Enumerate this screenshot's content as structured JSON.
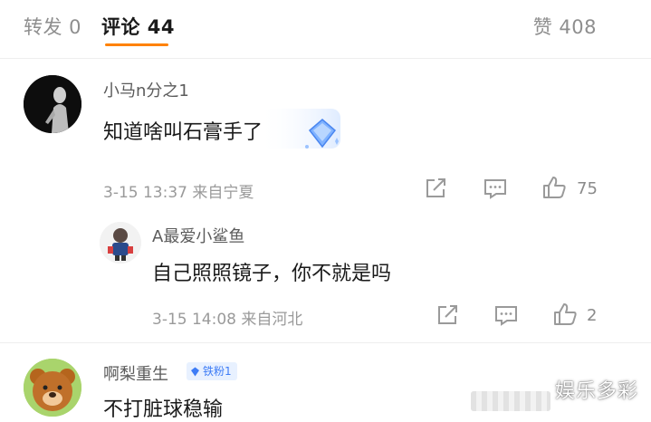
{
  "tabs": {
    "repost": "转发 0",
    "comments": "评论 44",
    "likes": "赞 408"
  },
  "comments": [
    {
      "user": "小马n分之1",
      "text": "知道啥叫石膏手了",
      "meta": "3-15 13:37 来自宁夏",
      "like_count": "75"
    },
    {
      "user": "A最爱小鲨鱼",
      "text": "自己照照镜子，你不就是吗",
      "meta": "3-15 14:08 来自河北",
      "like_count": "2"
    },
    {
      "user": "啊梨重生",
      "badge": "铁粉1",
      "text": "不打脏球稳输"
    }
  ],
  "watermark": "娱乐多彩",
  "colors": {
    "accent": "#ff8200",
    "badge_bg": "#e8f1ff",
    "badge_text": "#3d7cf6"
  }
}
